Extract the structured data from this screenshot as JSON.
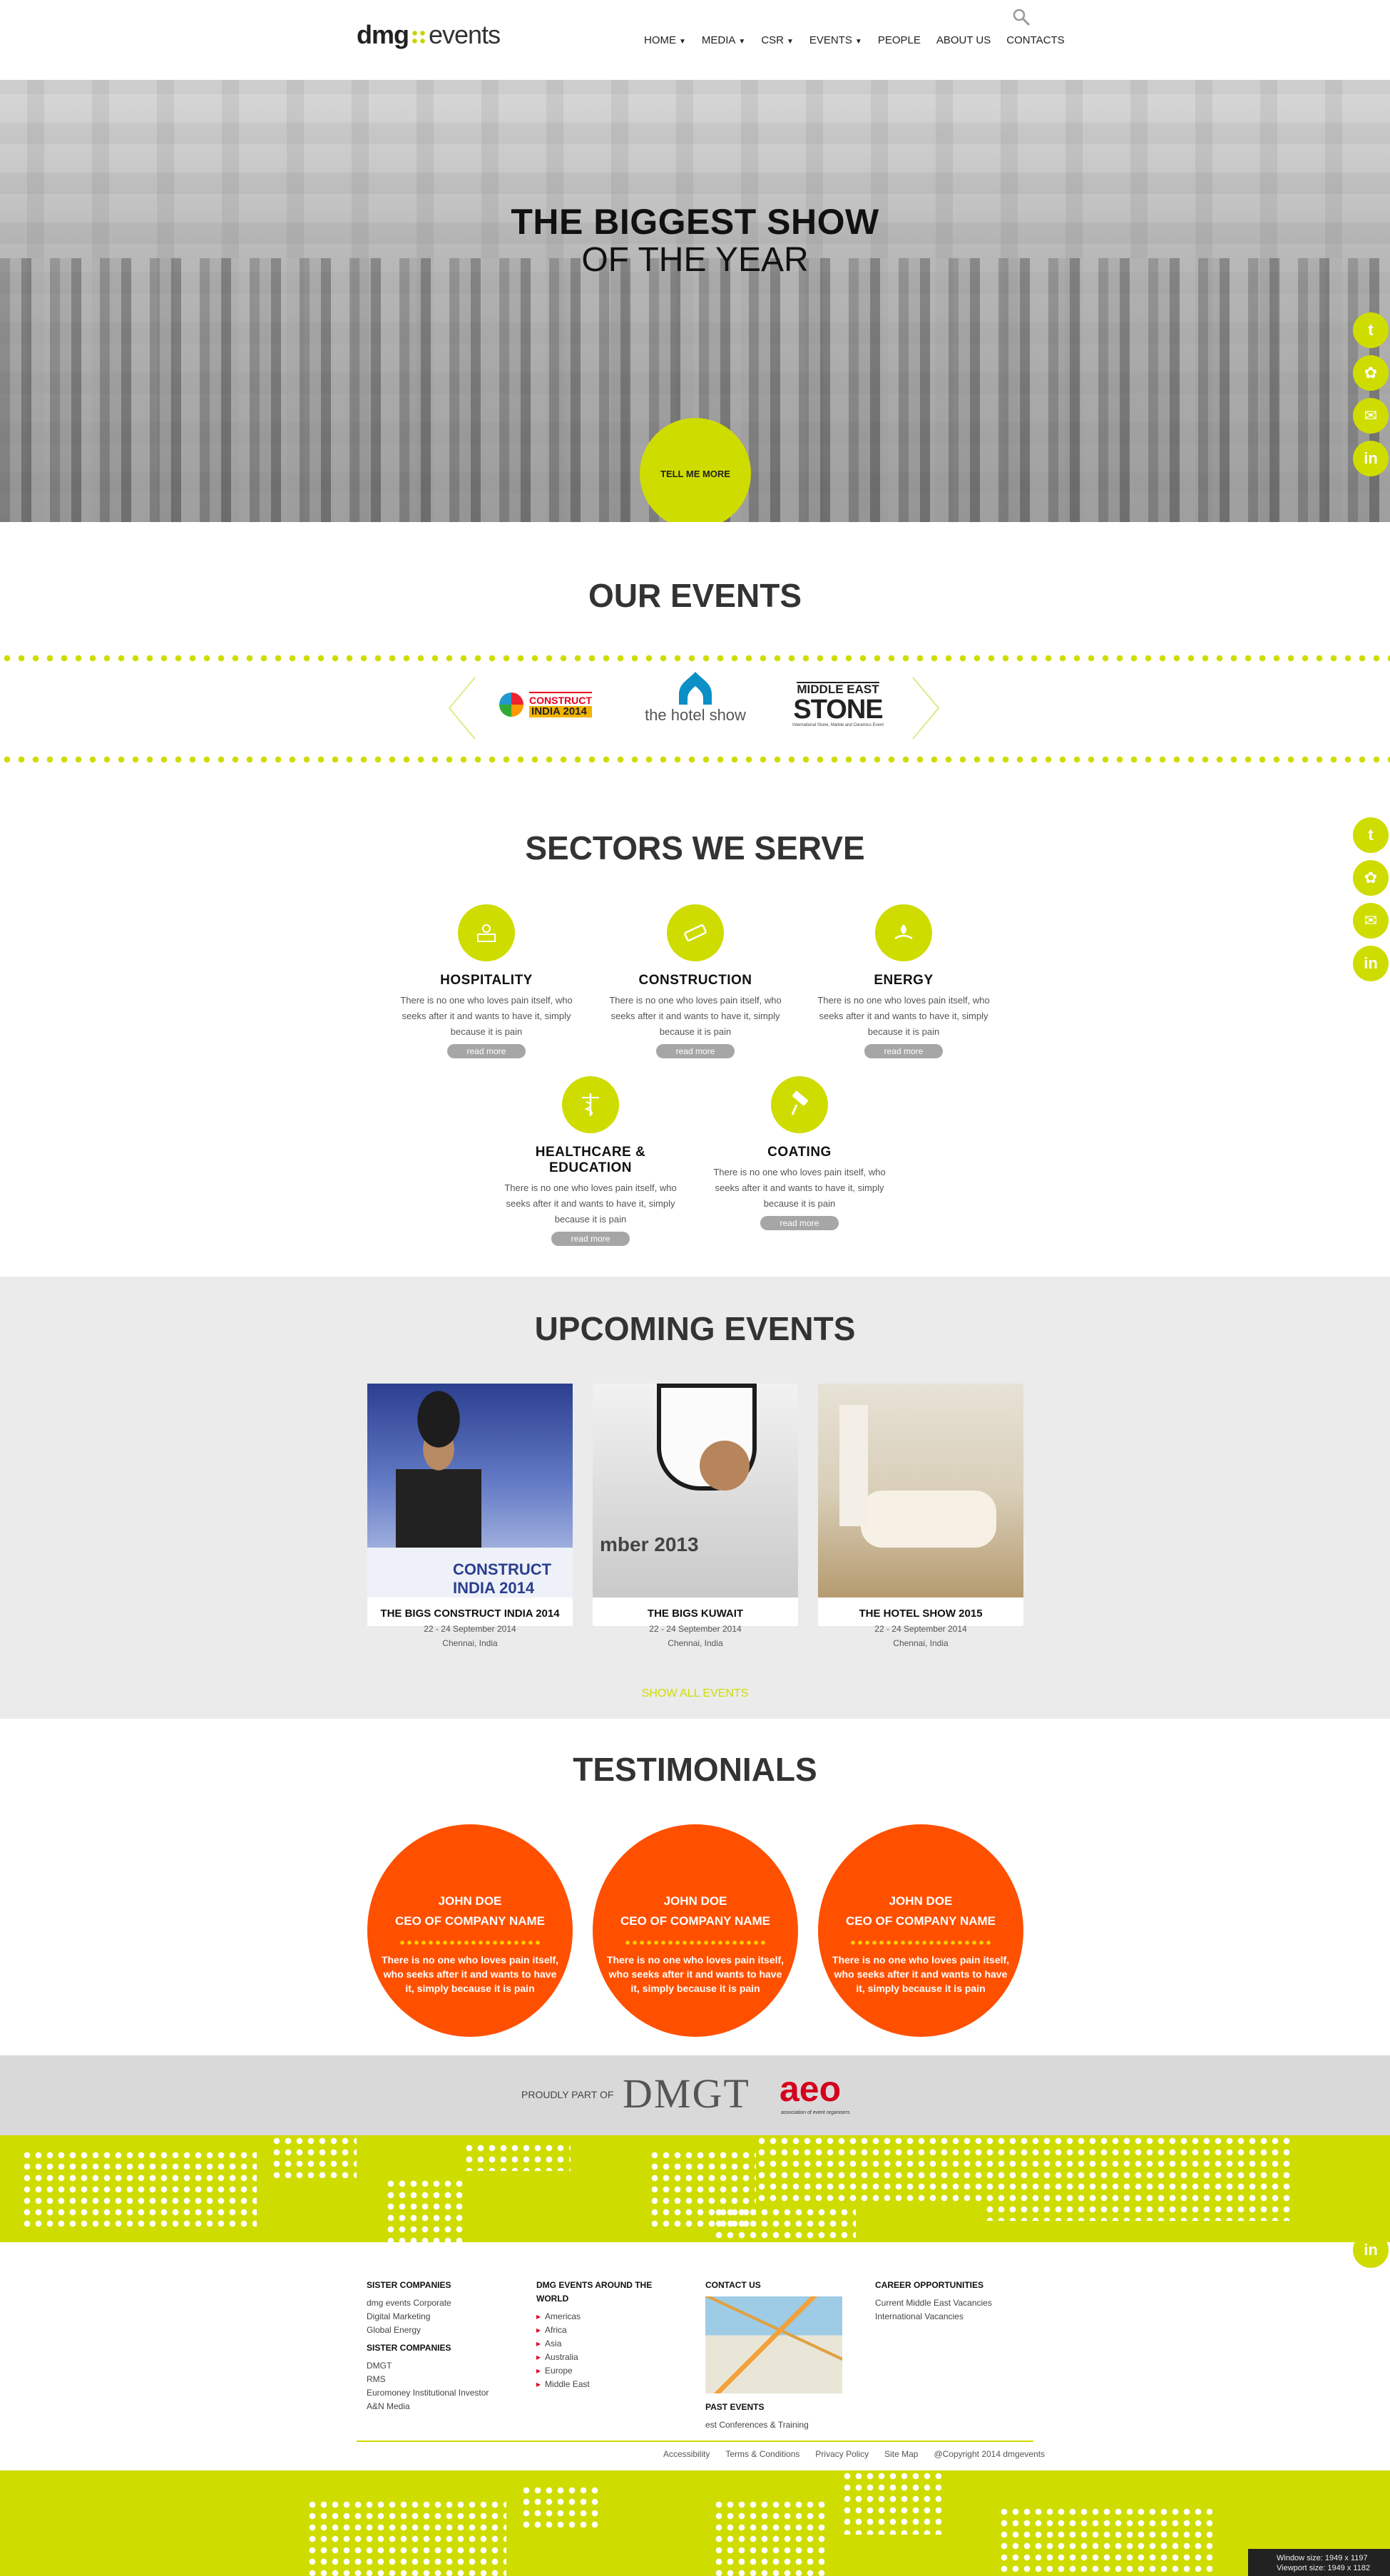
{
  "header": {
    "logo_dmg": "dmg",
    "logo_events": "events",
    "nav": [
      {
        "label": "HOME",
        "arrow": "▼"
      },
      {
        "label": "MEDIA",
        "arrow": "▼"
      },
      {
        "label": "CSR",
        "arrow": "▼"
      },
      {
        "label": "EVENTS",
        "arrow": "▼"
      },
      {
        "label": "PEOPLE",
        "arrow": ""
      },
      {
        "label": "ABOUT US",
        "arrow": ""
      },
      {
        "label": "CONTACTS",
        "arrow": ""
      }
    ]
  },
  "hero": {
    "title": "THE BIGGEST SHOW",
    "subtitle": "OF THE YEAR",
    "button": "TELL ME MORE"
  },
  "colors": {
    "accent": "#cfdc00",
    "orange": "#ff5000"
  },
  "social_icons": [
    "twitter-icon",
    "share-icon",
    "email-icon",
    "linkedin-icon"
  ],
  "events_section": {
    "title": "OUR EVENTS",
    "logos": [
      {
        "line1": "CONSTRUCT",
        "line2": "INDIA 2014"
      },
      {
        "line1": "the hotel show"
      },
      {
        "line1": "MIDDLE EAST",
        "line2": "STONE",
        "line3": "International Stone, Marble and Ceramics Event"
      }
    ]
  },
  "sectors": {
    "title": "SECTORS WE SERVE",
    "items": [
      {
        "name": "HOSPITALITY",
        "desc": "There is no one who loves pain itself, who seeks after it and wants to have it, simply because it is pain",
        "more": "read more"
      },
      {
        "name": "CONSTRUCTION",
        "desc": "There is no one who loves pain itself, who seeks after it and wants to have it, simply because it is pain",
        "more": "read more"
      },
      {
        "name": "ENERGY",
        "desc": "There is no one who loves pain itself, who seeks after it and wants to have it, simply because it is pain",
        "more": "read more"
      },
      {
        "name": "HEALTHCARE & EDUCATION",
        "desc": "There is no one who loves pain itself, who seeks after it and wants to have it, simply because it is pain",
        "more": "read more"
      },
      {
        "name": "COATING",
        "desc": "There is no one who loves pain itself, who seeks after it and wants to have it, simply because it is pain",
        "more": "read more"
      }
    ]
  },
  "upcoming": {
    "title": "UPCOMING EVENTS",
    "cards": [
      {
        "title": "THE BIGS CONSTRUCT INDIA 2014",
        "date": "22 - 24 September 2014",
        "place": "Chennai, India",
        "photo_text": "CONSTRUCT INDIA 2014"
      },
      {
        "title": "THE BIGS KUWAIT",
        "date": "22 - 24 September 2014",
        "place": "Chennai, India",
        "photo_text": "mber 2013"
      },
      {
        "title": "THE HOTEL SHOW 2015",
        "date": "22 - 24 September 2014",
        "place": "Chennai, India",
        "photo_text": ""
      }
    ],
    "show_all": "SHOW ALL EVENTS"
  },
  "testimonials": {
    "title": "TESTIMONIALS",
    "items": [
      {
        "name": "JOHN DOE",
        "role": "CEO OF COMPANY NAME",
        "quote": "There is no one who loves pain itself, who seeks after it and wants to have it, simply because it is pain"
      },
      {
        "name": "JOHN DOE",
        "role": "CEO OF COMPANY NAME",
        "quote": "There is no one who loves pain itself, who seeks after it and wants to have it, simply because it is pain"
      },
      {
        "name": "JOHN DOE",
        "role": "CEO OF COMPANY NAME",
        "quote": "There is no one who loves pain itself, who seeks after it and wants to have it, simply because it is pain"
      }
    ]
  },
  "proud": {
    "label": "PROUDLY PART OF",
    "dmgt": "DMGT",
    "aeo": "aeo",
    "aeo_sub": "association of event organisers"
  },
  "footer": {
    "col1": {
      "head1": "SISTER COMPANIES",
      "links1": [
        "dmg events Corporate",
        "Digital Marketing",
        "Global Energy"
      ],
      "head2": "SISTER COMPANIES",
      "links2": [
        "DMGT",
        "RMS",
        "Euromoney Institutional Investor",
        "A&N Media"
      ]
    },
    "col2": {
      "head": "DMG EVENTS AROUND THE WORLD",
      "links": [
        "Americas",
        "Africa",
        "Asia",
        "Australia",
        "Europe",
        "Middle East"
      ]
    },
    "col3": {
      "head": "CONTACT US",
      "past_head": "PAST EVENTS",
      "past_link": "est Conferences & Training"
    },
    "col4": {
      "head": "CAREER OPPORTUNITIES",
      "links": [
        "Current Middle East Vacancies",
        "International Vacancies"
      ]
    },
    "bottom_links": [
      "Accessibility",
      "Terms & Conditions",
      "Privacy Policy",
      "Site Map",
      "@Copyright 2014 dmgevents"
    ]
  },
  "window_size": {
    "line1": "Window size: 1949 x 1197",
    "line2": "Viewport size: 1949 x 1182"
  }
}
